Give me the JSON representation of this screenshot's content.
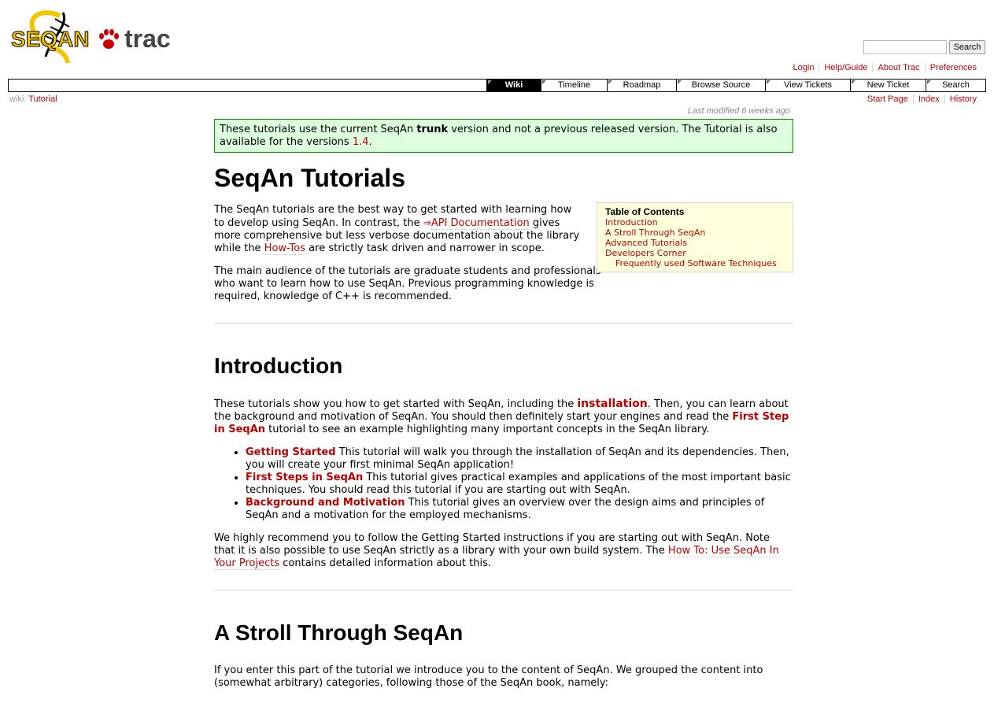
{
  "header": {
    "logo_seqan": "SEQAN",
    "logo_trac": "trac",
    "search_placeholder": "",
    "search_button": "Search"
  },
  "metanav": [
    "Login",
    "Help/Guide",
    "About Trac",
    "Preferences"
  ],
  "mainnav": {
    "tabs": [
      "Wiki",
      "Timeline",
      "Roadmap",
      "Browse Source",
      "View Tickets",
      "New Ticket",
      "Search"
    ],
    "active": "Wiki"
  },
  "breadcrumb": {
    "prefix": "wiki:",
    "page": "Tutorial"
  },
  "ctxnav": [
    "Start Page",
    "Index",
    "History"
  ],
  "last_modified": "Last modified 6 weeks ago",
  "notice": {
    "t1": "These tutorials use the current SeqAn ",
    "strong": "trunk",
    "t2": " version and not a previous released version. The Tutorial is also available for the versions ",
    "link": "1.4",
    "t3": "."
  },
  "title": "SeqAn Tutorials",
  "intro_p1": {
    "t1": "The SeqAn tutorials are the best way to get started with learning how to develop using SeqAn. In contrast, the ",
    "link1": "API Documentation",
    "t2": " gives more comprehensive but less verbose documentation about the library while the ",
    "link2": "How-Tos",
    "t3": " are strictly task driven and narrower in scope."
  },
  "intro_p2": "The main audience of the tutorials are graduate students and professionals who want to learn how to use SeqAn. Previous programming knowledge is required, knowledge of C++ is recommended.",
  "toc": {
    "title": "Table of Contents",
    "items": [
      "Introduction",
      "A Stroll Through SeqAn",
      "Advanced Tutorials",
      "Developers Corner"
    ],
    "subitem": "Frequently used Software Techniques"
  },
  "introduction": {
    "heading": "Introduction",
    "p1": {
      "t1": "These tutorials show you how to get started with SeqAn, including the ",
      "link1": "installation",
      "t2": ". Then, you can learn about the background and motivation of SeqAn. You should then definitely start your engines and read the ",
      "link2": "First Step in SeqAn",
      "t3": " tutorial to see an example highlighting many important concepts in the SeqAn library."
    },
    "list": [
      {
        "link": "Getting Started",
        "text": " This tutorial will walk you through the installation of SeqAn and its dependencies. Then, you will create your first minimal SeqAn application!"
      },
      {
        "link": "First Steps in SeqAn",
        "text": " This tutorial gives practical examples and applications of the most important basic techniques. You should read this tutorial if you are starting out with SeqAn."
      },
      {
        "link": "Background and Motivation",
        "text": " This tutorial gives an overview over the design aims and principles of SeqAn and a motivation for the employed mechanisms."
      }
    ],
    "p2": {
      "t1": "We highly recommend you to follow the Getting Started instructions if you are starting out with SeqAn. Note that it is also possible to use SeqAn strictly as a library with your own build system. The ",
      "link": "How To: Use SeqAn In Your Projects",
      "t2": " contains detailed information about this."
    }
  },
  "stroll": {
    "heading": "A Stroll Through SeqAn",
    "p1": "If you enter this part of the tutorial we introduce you to the content of SeqAn. We grouped the content into (somewhat arbitrary) categories, following those of the SeqAn book, namely:"
  },
  "colors": {
    "link": "#bb0000",
    "notice_bg": "#ddffdd",
    "notice_border": "#009900",
    "toc_bg": "#ffffdd"
  }
}
